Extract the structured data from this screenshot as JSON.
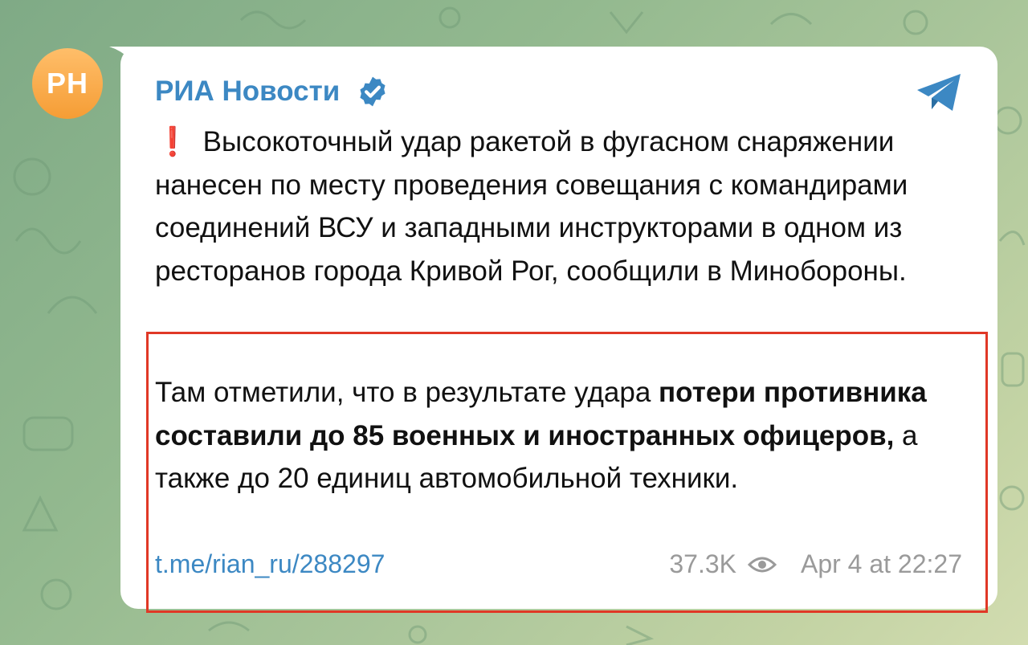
{
  "channel": {
    "avatar_initials": "PH",
    "avatar_color": "#f7a83e",
    "name": "РИА Новости",
    "accent_color": "#3c88c3"
  },
  "post": {
    "alert_icon": "❗",
    "paragraph1": "Высокоточный удар ракетой в фугасном снаряжении нанесен по месту проведения совещания с командирами соединений ВСУ и западными инструкторами в одном из ресторанов города Кривой Рог, сообщили в Минобороны.",
    "paragraph2_start": "Там отметили, что в результате удара ",
    "paragraph2_bold": "потери противника составили до 85 военных и иностранных офицеров,",
    "paragraph2_end": " а также до 20 единиц автомобильной техники.",
    "link": "t.me/rian_ru/288297",
    "views": "37.3K",
    "date": "Apr 4 at 22:27"
  },
  "highlight_color": "#e03826"
}
